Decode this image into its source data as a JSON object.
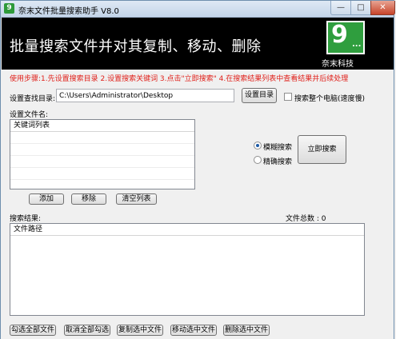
{
  "window": {
    "title": "奈末文件批量搜索助手 V8.0",
    "app_icon": "9"
  },
  "banner": {
    "title": "批量搜索文件并对其复制、移动、删除",
    "logo_glyph": "9",
    "logo_dots": "...",
    "logo_text": "奈末科技"
  },
  "usage_text": "使用步骤:1.先设置搜索目录 2.设置搜索关键词 3.点击\"立即搜索\" 4.在搜索结果列表中查看结果并后续处理",
  "search_dir": {
    "label": "设置查找目录:",
    "value": "C:\\Users\\Administrator\\Desktop",
    "button": "设置目录",
    "whole_pc_label": "搜索整个电脑(速度慢)"
  },
  "filename_section": {
    "label": "设置文件名:",
    "list_header": "关键词列表",
    "add_button": "添加",
    "remove_button": "移除",
    "clear_button": "清空列表"
  },
  "search_mode": {
    "fuzzy_label": "模糊搜索",
    "exact_label": "精确搜索",
    "selected": "模糊搜索",
    "search_button": "立即搜索"
  },
  "results": {
    "label": "搜索结果:",
    "total_label": "文件总数 :",
    "total_value": "0",
    "list_header": "文件路径"
  },
  "bottom_buttons": {
    "select_all": "勾选全部文件",
    "deselect_all": "取消全部勾选",
    "copy": "复制选中文件",
    "move": "移动选中文件",
    "delete": "删除选中文件"
  },
  "colors": {
    "banner_bg": "#000000",
    "logo_green": "#2f9e3e",
    "usage_red": "#e0201a"
  }
}
